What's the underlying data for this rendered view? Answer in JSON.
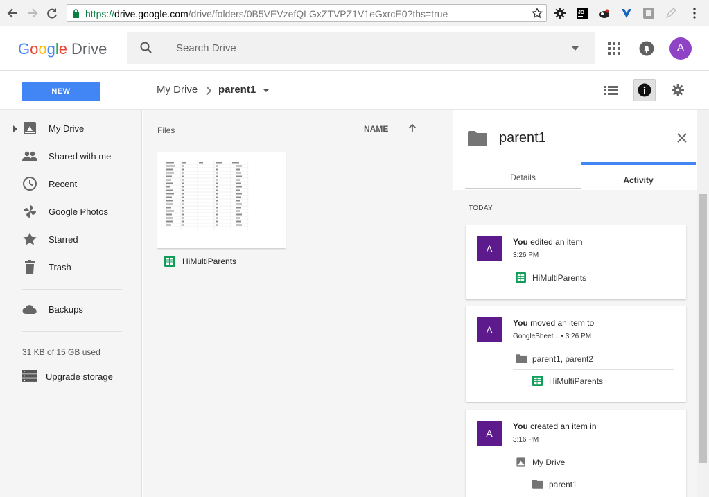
{
  "browser": {
    "url_scheme": "https://",
    "url_host": "drive.google.com",
    "url_rest": "/drive/folders/0B5VEVzefQLGxZTVPZ1V1eGxrcE0?ths=true"
  },
  "header": {
    "logo_letters": [
      "G",
      "o",
      "o",
      "g",
      "l",
      "e"
    ],
    "logo_product": "Drive",
    "search_placeholder": "Search Drive",
    "avatar_letter": "A"
  },
  "toolbar": {
    "new_label": "NEW",
    "breadcrumb_root": "My Drive",
    "breadcrumb_current": "parent1"
  },
  "sidebar": {
    "items": [
      {
        "label": "My Drive",
        "icon": "my-drive-icon"
      },
      {
        "label": "Shared with me",
        "icon": "people-icon"
      },
      {
        "label": "Recent",
        "icon": "clock-icon"
      },
      {
        "label": "Google Photos",
        "icon": "pinwheel-icon"
      },
      {
        "label": "Starred",
        "icon": "star-icon"
      },
      {
        "label": "Trash",
        "icon": "trash-icon"
      },
      {
        "label": "Backups",
        "icon": "cloud-icon"
      }
    ],
    "storage_used": "31 KB of 15 GB used",
    "upgrade_label": "Upgrade storage"
  },
  "main": {
    "files_label": "Files",
    "sort_label": "NAME",
    "file": {
      "name": "HiMultiParents"
    }
  },
  "panel": {
    "title": "parent1",
    "tabs": [
      "Details",
      "Activity"
    ],
    "active_tab": "Activity",
    "section_label": "TODAY",
    "activities": [
      {
        "avatar": "A",
        "actor": "You",
        "action": " edited an item",
        "time": "3:26 PM",
        "items": [
          "HiMultiParents"
        ]
      },
      {
        "avatar": "A",
        "actor": "You",
        "action": " moved an item to",
        "source": "GoogleSheet...",
        "time": "• 3:26 PM",
        "destination": "parent1, parent2",
        "items": [
          "HiMultiParents"
        ]
      },
      {
        "avatar": "A",
        "actor": "You",
        "action": " created an item in",
        "time": "3:16 PM",
        "location": "My Drive",
        "items": [
          "parent1"
        ]
      }
    ]
  },
  "colors": {
    "accent": "#4285f4",
    "avatar": "#5c1a8c",
    "sheets_green": "#0f9d58"
  }
}
